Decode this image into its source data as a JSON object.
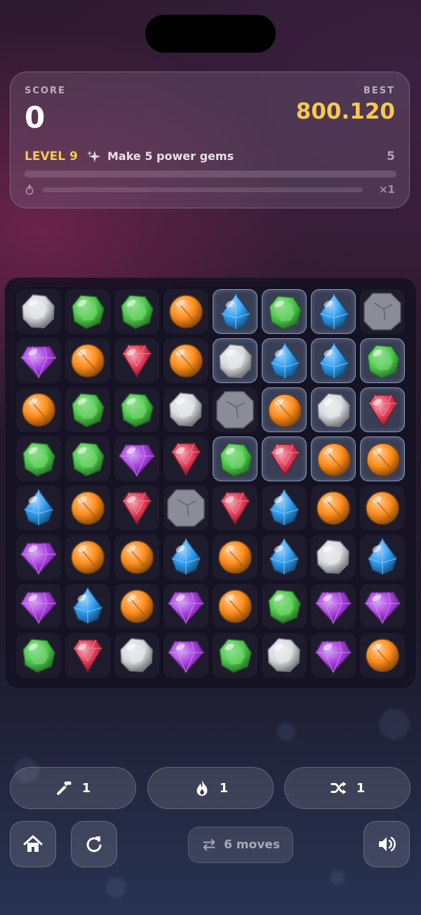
{
  "score_card": {
    "score_label": "SCORE",
    "score_value": "0",
    "best_label": "BEST",
    "best_value": "800.120",
    "level_label": "LEVEL 9",
    "objective_icon": "sparkle-icon",
    "objective_text": "Make 5 power gems",
    "objective_remaining": "5",
    "objective_progress": 0,
    "combo_icon": "flame-icon",
    "combo_progress": 0,
    "combo_multiplier": "×1"
  },
  "board": {
    "rows": 8,
    "cols": 8,
    "legend": {
      "W": "white stone gem",
      "G": "green gem",
      "O": "orange orb",
      "B": "blue diamond",
      "R": "red ruby",
      "P": "purple amethyst",
      "X": "grey rock blocker"
    },
    "grid": [
      [
        "W",
        "G",
        "G",
        "O",
        "B",
        "G",
        "B",
        "X"
      ],
      [
        "P",
        "O",
        "R",
        "O",
        "W",
        "B",
        "B",
        "G"
      ],
      [
        "O",
        "G",
        "G",
        "W",
        "X",
        "O",
        "W",
        "R"
      ],
      [
        "G",
        "G",
        "P",
        "R",
        "G",
        "R",
        "O",
        "O"
      ],
      [
        "B",
        "O",
        "R",
        "X",
        "R",
        "B",
        "O",
        "O"
      ],
      [
        "P",
        "O",
        "O",
        "B",
        "O",
        "B",
        "W",
        "B"
      ],
      [
        "P",
        "B",
        "O",
        "P",
        "O",
        "G",
        "P",
        "P"
      ],
      [
        "G",
        "R",
        "W",
        "P",
        "G",
        "W",
        "P",
        "O"
      ]
    ],
    "ice": [
      [
        false,
        false,
        false,
        false,
        true,
        true,
        true,
        false
      ],
      [
        false,
        false,
        false,
        false,
        true,
        true,
        true,
        true
      ],
      [
        false,
        false,
        false,
        false,
        false,
        true,
        true,
        true
      ],
      [
        false,
        false,
        false,
        false,
        true,
        true,
        true,
        true
      ],
      [
        false,
        false,
        false,
        false,
        false,
        false,
        false,
        false
      ],
      [
        false,
        false,
        false,
        false,
        false,
        false,
        false,
        false
      ],
      [
        false,
        false,
        false,
        false,
        false,
        false,
        false,
        false
      ],
      [
        false,
        false,
        false,
        false,
        false,
        false,
        false,
        false
      ]
    ]
  },
  "boosters": [
    {
      "name": "hammer",
      "icon": "hammer-icon",
      "count": "1"
    },
    {
      "name": "fire",
      "icon": "flame-icon",
      "count": "1"
    },
    {
      "name": "shuffle",
      "icon": "shuffle-icon",
      "count": "1"
    }
  ],
  "controls": {
    "home_icon": "home-icon",
    "restart_icon": "restart-icon",
    "moves_icon": "swap-arrows-icon",
    "moves_text": "6 moves",
    "sound_icon": "speaker-icon"
  },
  "colors": {
    "gold": "#f6c94f",
    "green": "#4cc94a",
    "orange": "#ff8c1a",
    "blue": "#2d9bf0",
    "red": "#e23a55",
    "purple": "#a73ee0",
    "white": "#d9dadf",
    "rock": "#8a8d97"
  }
}
